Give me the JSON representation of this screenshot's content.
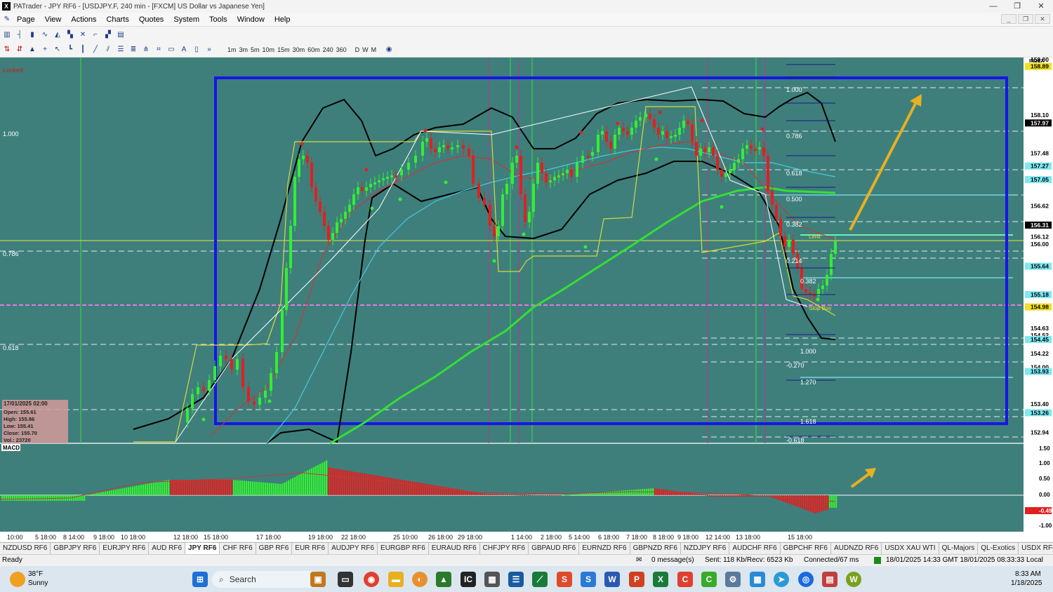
{
  "window": {
    "title": "PATrader - JPY RF6 - [USDJPY.F, 240 min - [FXCM] US Dollar vs Japanese Yen]"
  },
  "menu": [
    "Page",
    "View",
    "Actions",
    "Charts",
    "Quotes",
    "System",
    "Tools",
    "Window",
    "Help"
  ],
  "timeframes": [
    "1m",
    "3m",
    "5m",
    "10m",
    "15m",
    "30m",
    "60m",
    "240",
    "360",
    "D",
    "W",
    "M"
  ],
  "chart": {
    "locked_label": "Locked",
    "index_label": "INDEX",
    "left_fib_labels": [
      "1.000",
      "0.786",
      "0.618"
    ],
    "price_axis": [
      "159.00",
      "158.89",
      "158.10",
      "157.97",
      "157.48",
      "157.27",
      "157.05",
      "156.62",
      "156.31",
      "156.12",
      "156.00",
      "155.64",
      "155.18",
      "154.98",
      "154.63",
      "154.52",
      "154.45",
      "154.22",
      "154.00",
      "153.93",
      "153.40",
      "153.26",
      "152.94"
    ],
    "right_fib_labels": [
      "1.000",
      "0.786",
      "0.618",
      "0.500",
      "0.382",
      "0.214",
      "0.382",
      "1.000",
      "-0.270",
      "1.270",
      "1.618",
      "-0.618"
    ],
    "limit_label": "Limit",
    "buy_label": "Stop Buy",
    "time_axis": [
      "10:00",
      "5 18:00",
      "8 14:00",
      "9 18:00",
      "10 18:00",
      "12 18:00",
      "15 18:00",
      "17 18:00",
      "19 18:00",
      "22 18:00",
      "25 10:00",
      "26 18:00",
      "29 18:00",
      "1 14:00",
      "2 18:00",
      "5 14:00",
      "6 18:00",
      "7 18:00",
      "8 18:00",
      "9 18:00",
      "12 14:00",
      "13 18:00",
      "15 18:00"
    ],
    "info_box": {
      "date": "17/01/2025 02:00",
      "open": "Open: 155.61",
      "high": "High: 155.86",
      "low": "Low: 155.41",
      "close": "Close: 155.70",
      "vol": "Vol.: 23720"
    },
    "macd_label": "MACD",
    "macd_axis": [
      "1.50",
      "1.00",
      "0.50",
      "0.00",
      "-0.49",
      "-1.00"
    ]
  },
  "tabs": [
    "NZDUSD RF6",
    "GBPJPY RF6",
    "EURJPY RF6",
    "AUD RF6",
    "JPY RF6",
    "CHF RF6",
    "GBP RF6",
    "EUR RF6",
    "AUDJPY RF6",
    "EURGBP RF6",
    "EURAUD RF6",
    "CHFJPY RF6",
    "GBPAUD RF6",
    "EURNZD RF6",
    "GBPNZD RF6",
    "NZDJPY RF6",
    "AUDCHF RF6",
    "GBPCHF RF6",
    "AUDNZD RF6",
    "USDX XAU WTI",
    "QL-Majors",
    "QL-Exotics",
    "USDX RF6",
    "Bitcoin",
    "SP500 RF6",
    "DJIA"
  ],
  "active_tab": "JPY RF6",
  "status": {
    "ready": "Ready",
    "messages": "0 message(s)",
    "sent": "Sent: 118 Kb/Recv: 6523 Kb",
    "connected": "Connected/67 ms",
    "time": "18/01/2025 14:33 GMT  18/01/2025 08:33:33 Local"
  },
  "taskbar": {
    "temp": "38°F",
    "weather": "Sunny",
    "search": "Search",
    "clock_time": "8:33 AM",
    "clock_date": "1/18/2025"
  }
}
